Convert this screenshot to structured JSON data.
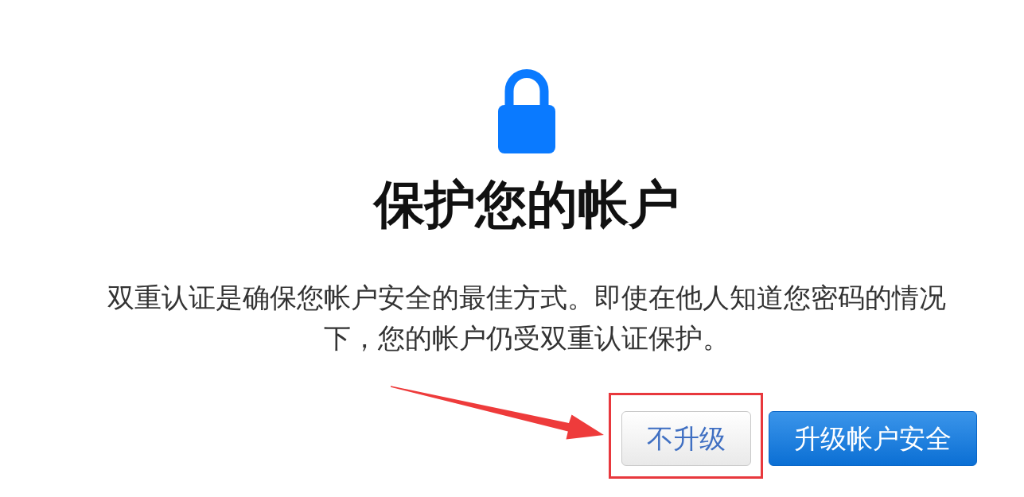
{
  "title": "保护您的帐户",
  "description": "双重认证是确保您帐户安全的最佳方式。即使在他人知道您密码的情况下，您的帐户仍受双重认证保护。",
  "buttons": [
    {
      "label": "不升级",
      "kind": "secondary",
      "highlighted": true
    },
    {
      "label": "升级帐户安全",
      "kind": "primary",
      "highlighted": false
    }
  ]
}
